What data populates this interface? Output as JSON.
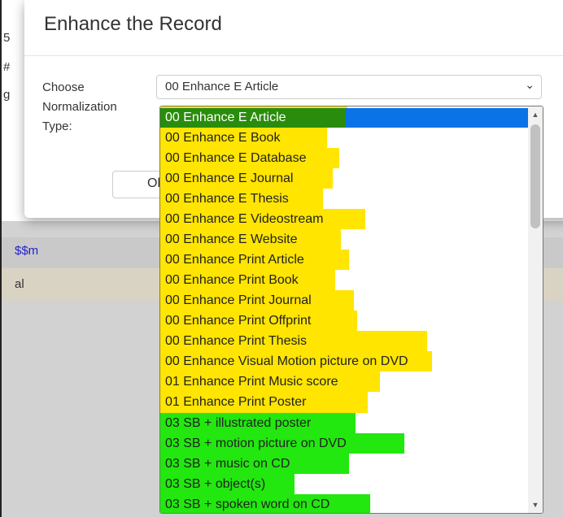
{
  "background": {
    "fragments": [
      "5",
      "#",
      "g"
    ],
    "link_text": "$$m",
    "row_text": "al"
  },
  "modal": {
    "title": "Enhance the Record",
    "field_label_lines": [
      "Choose",
      "Normalization",
      "Type:"
    ],
    "selected_value": "00 Enhance E Article",
    "ok_label": "Ok"
  },
  "dropdown": {
    "options": [
      "00 Enhance E Article",
      "00 Enhance E Book",
      "00 Enhance E Database",
      "00 Enhance E Journal",
      "00 Enhance E Thesis",
      "00 Enhance E Videostream",
      "00 Enhance E Website",
      "00 Enhance Print Article",
      "00 Enhance Print Book",
      "00 Enhance Print Journal",
      "00 Enhance Print Offprint",
      "00 Enhance Print Thesis",
      "00 Enhance Visual Motion picture on DVD",
      "01 Enhance Print Music score",
      "01 Enhance Print Poster",
      "03 SB + illustrated poster",
      "03 SB + motion picture on DVD",
      "03 SB + music on CD",
      "03 SB + object(s)",
      "03 SB + spoken word on CD"
    ],
    "highlight_colors": {
      "yellow": "#ffe500",
      "green": "#22e80f",
      "selected": "#0a73e6"
    }
  }
}
